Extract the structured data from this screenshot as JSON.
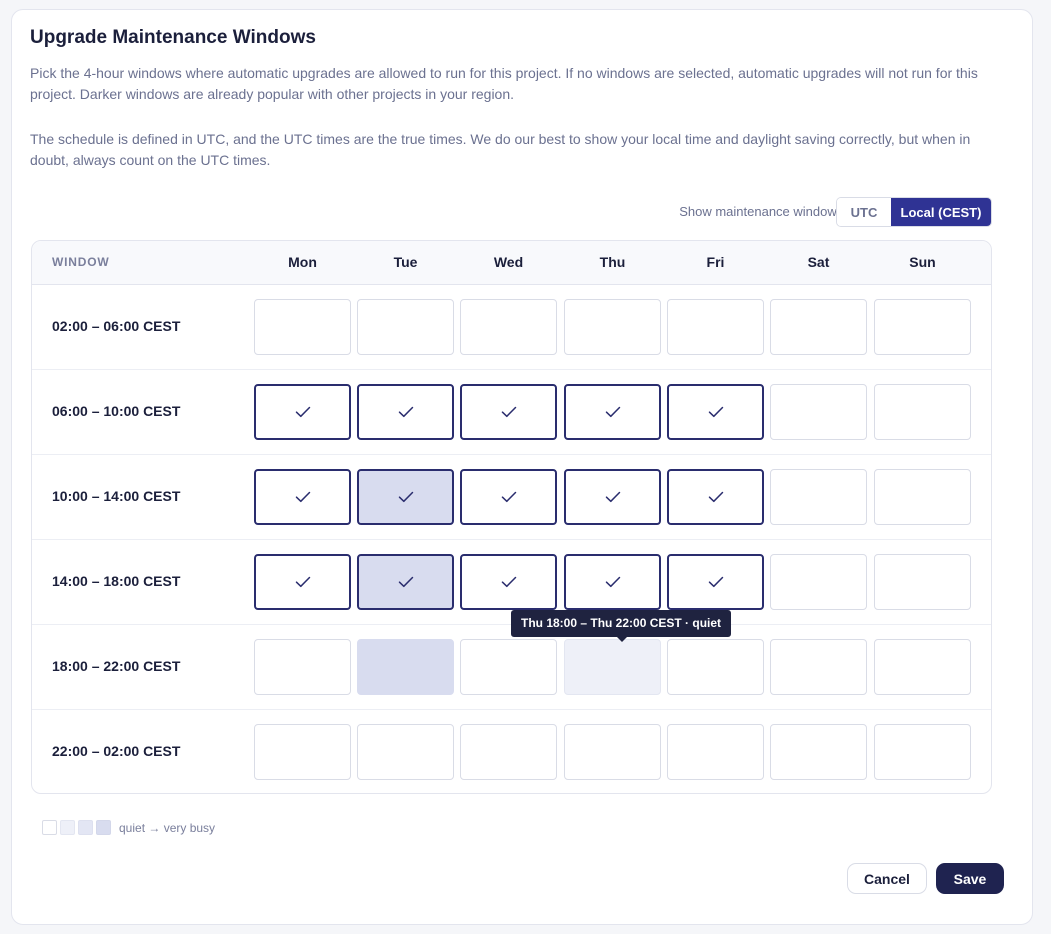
{
  "header": {
    "title": "Upgrade Maintenance Windows",
    "description_1": "Pick the 4-hour windows where automatic upgrades are allowed to run for this project. If no windows are selected, automatic upgrades will not run for this project. Darker windows are already popular with other projects in your region.",
    "description_2": "The schedule is defined in UTC, and the UTC times are the true times. We do our best to show your local time and daylight saving correctly, but when in doubt, always count on the UTC times."
  },
  "timezone_toggle": {
    "label": "Show maintenance windows in",
    "options": [
      "UTC",
      "Local (CEST)"
    ],
    "selected": "Local (CEST)"
  },
  "grid": {
    "window_header": "WINDOW",
    "days": [
      "Mon",
      "Tue",
      "Wed",
      "Thu",
      "Fri",
      "Sat",
      "Sun"
    ],
    "rows": [
      {
        "label": "02:00 – 06:00 CEST",
        "selected": [
          false,
          false,
          false,
          false,
          false,
          false,
          false
        ],
        "busyness": [
          0,
          0,
          0,
          0,
          0,
          0,
          0
        ]
      },
      {
        "label": "06:00 – 10:00 CEST",
        "selected": [
          true,
          true,
          true,
          true,
          true,
          false,
          false
        ],
        "busyness": [
          0,
          0,
          0,
          0,
          0,
          0,
          0
        ]
      },
      {
        "label": "10:00 – 14:00 CEST",
        "selected": [
          true,
          true,
          true,
          true,
          true,
          false,
          false
        ],
        "busyness": [
          0,
          3,
          0,
          0,
          0,
          0,
          0
        ]
      },
      {
        "label": "14:00 – 18:00 CEST",
        "selected": [
          true,
          true,
          true,
          true,
          true,
          false,
          false
        ],
        "busyness": [
          0,
          3,
          0,
          0,
          0,
          0,
          0
        ]
      },
      {
        "label": "18:00 – 22:00 CEST",
        "selected": [
          false,
          false,
          false,
          false,
          false,
          false,
          false
        ],
        "busyness": [
          0,
          3,
          0,
          1,
          0,
          0,
          0
        ]
      },
      {
        "label": "22:00 – 02:00 CEST",
        "selected": [
          false,
          false,
          false,
          false,
          false,
          false,
          false
        ],
        "busyness": [
          0,
          0,
          0,
          0,
          0,
          0,
          0
        ]
      }
    ]
  },
  "tooltip": {
    "text": "Thu 18:00 – Thu 22:00 CEST · quiet"
  },
  "legend": {
    "levels": 4,
    "text": "quiet → very busy"
  },
  "actions": {
    "cancel_label": "Cancel",
    "save_label": "Save"
  },
  "colors": {
    "accent": "#2f3394",
    "selected_border": "#2a2d6e",
    "busy_1": "#eef0f8",
    "busy_3": "#d8dcef"
  }
}
